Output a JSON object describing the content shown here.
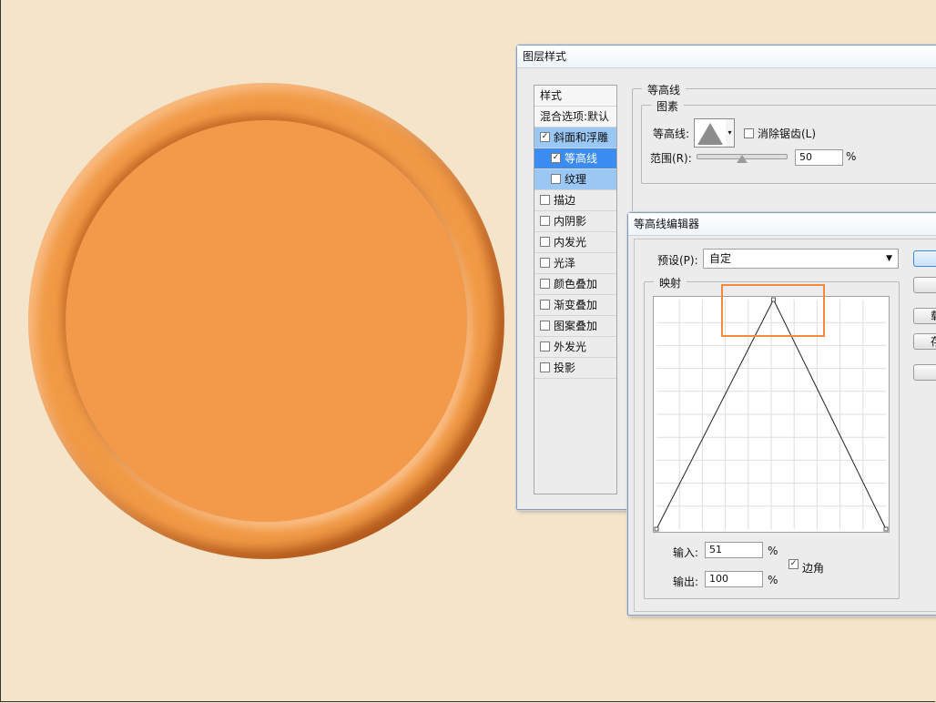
{
  "layer_style_dialog": {
    "title": "图层样式",
    "styles_header": "样式",
    "blend_options": "混合选项:默认",
    "items": [
      {
        "label": "斜面和浮雕",
        "checked": true
      },
      {
        "label": "等高线",
        "checked": true
      },
      {
        "label": "纹理",
        "checked": false
      },
      {
        "label": "描边",
        "checked": false
      },
      {
        "label": "内阴影",
        "checked": false
      },
      {
        "label": "内发光",
        "checked": false
      },
      {
        "label": "光泽",
        "checked": false
      },
      {
        "label": "颜色叠加",
        "checked": false
      },
      {
        "label": "渐变叠加",
        "checked": false
      },
      {
        "label": "图案叠加",
        "checked": false
      },
      {
        "label": "外发光",
        "checked": false
      },
      {
        "label": "投影",
        "checked": false
      }
    ],
    "section_title": "等高线",
    "subsection_title": "图素",
    "contour_label": "等高线:",
    "anti_alias_label": "消除锯齿(L)",
    "anti_alias_checked": false,
    "range_label": "范围(R):",
    "range_value": "50",
    "range_unit": "%"
  },
  "contour_editor": {
    "title": "等高线编辑器",
    "preset_label": "预设(P):",
    "preset_value": "自定",
    "mapping_title": "映射",
    "input_label": "输入:",
    "input_value": "51",
    "output_label": "输出:",
    "output_value": "100",
    "percent": "%",
    "corner_label": "边角",
    "corner_checked": true,
    "side_button_1": "载",
    "side_button_2": "存",
    "curve_points": [
      [
        0,
        0
      ],
      [
        51,
        100
      ],
      [
        100,
        0
      ]
    ]
  },
  "colors": {
    "canvas_bg": "#f4e4ca",
    "plate": "#f2994a",
    "highlight_box": "#f08a3c",
    "selection_blue": "#3b8cf0"
  }
}
